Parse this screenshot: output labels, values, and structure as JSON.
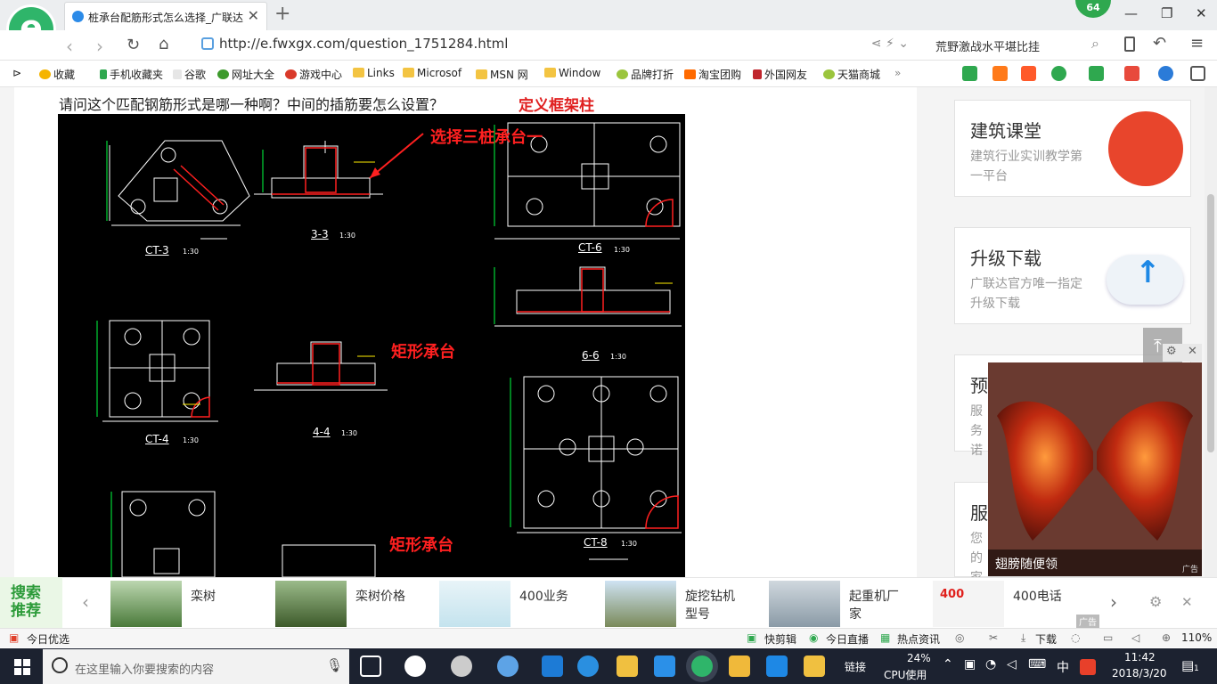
{
  "browser": {
    "tab_title": "桩承台配筋形式怎么选择_广联达",
    "tab_close": "✕",
    "new_tab": "+",
    "badge": "64",
    "url": "http://e.fwxgx.com/question_1751284.html",
    "search_query": "荒野激战水平堪比挂",
    "window": {
      "minimize": "—",
      "restore": "❐",
      "close": "✕"
    }
  },
  "bookmarks": [
    {
      "label": "收藏",
      "color": "#f5b400"
    },
    {
      "label": "手机收藏夹",
      "color": "#2fa84f"
    },
    {
      "label": "谷歌",
      "color": "#dddddd"
    },
    {
      "label": "网址大全",
      "color": "#3d9a2c"
    },
    {
      "label": "游戏中心",
      "color": "#d93a2a"
    },
    {
      "label": "Links",
      "color": "#f3c442"
    },
    {
      "label": "Microsof",
      "color": "#f3c442"
    },
    {
      "label": "MSN 网",
      "color": "#f3c442"
    },
    {
      "label": "Window",
      "color": "#f3c442"
    },
    {
      "label": "品牌打折",
      "color": "#9bc53d"
    },
    {
      "label": "淘宝团购",
      "color": "#ff6a00"
    },
    {
      "label": "外国网友",
      "color": "#c0262d"
    },
    {
      "label": "天猫商城",
      "color": "#9bc53d"
    }
  ],
  "content": {
    "question": "请问这个匹配钢筋形式是哪一种啊？中间的插筋要怎么设置？",
    "annot_define": "定义框架柱",
    "annot_three_pile": "选择三桩承台一",
    "annot_rect1": "矩形承台",
    "annot_rect2": "矩形承台",
    "drawing_labels": {
      "ct3": "CT-3",
      "ct4": "CT-4",
      "ct6": "CT-6",
      "ct8": "CT-8",
      "s33": "3-3",
      "s44": "4-4",
      "s66": "6-6",
      "scale": "1:30"
    }
  },
  "sidebar": {
    "card1": {
      "title": "建筑课堂",
      "sub": "建筑行业实训教学第一平台"
    },
    "card2": {
      "title": "升级下载",
      "sub": "广联达官方唯一指定升级下载"
    },
    "card3": {
      "title": "预",
      "sub": "服务诺"
    },
    "card4": {
      "title": "服",
      "sub": "您的家"
    }
  },
  "popup": {
    "caption": "翅膀随便领",
    "ad": "广告"
  },
  "promo": {
    "label": "搜索推荐",
    "items": [
      "栾树",
      "栾树价格",
      "400业务",
      "旋挖钻机型号",
      "起重机厂家",
      "400电话"
    ],
    "ad": "广告"
  },
  "statusbar": {
    "left": "今日优选",
    "items": [
      "快剪辑",
      "今日直播",
      "热点资讯",
      "下载"
    ],
    "zoom": "110%"
  },
  "taskbar": {
    "search_placeholder": "在这里输入你要搜索的内容",
    "link_label": "链接",
    "cpu_percent": "24%",
    "cpu_label": "CPU使用",
    "ime": "中",
    "time": "11:42",
    "date": "2018/3/20",
    "notifications": "1"
  }
}
